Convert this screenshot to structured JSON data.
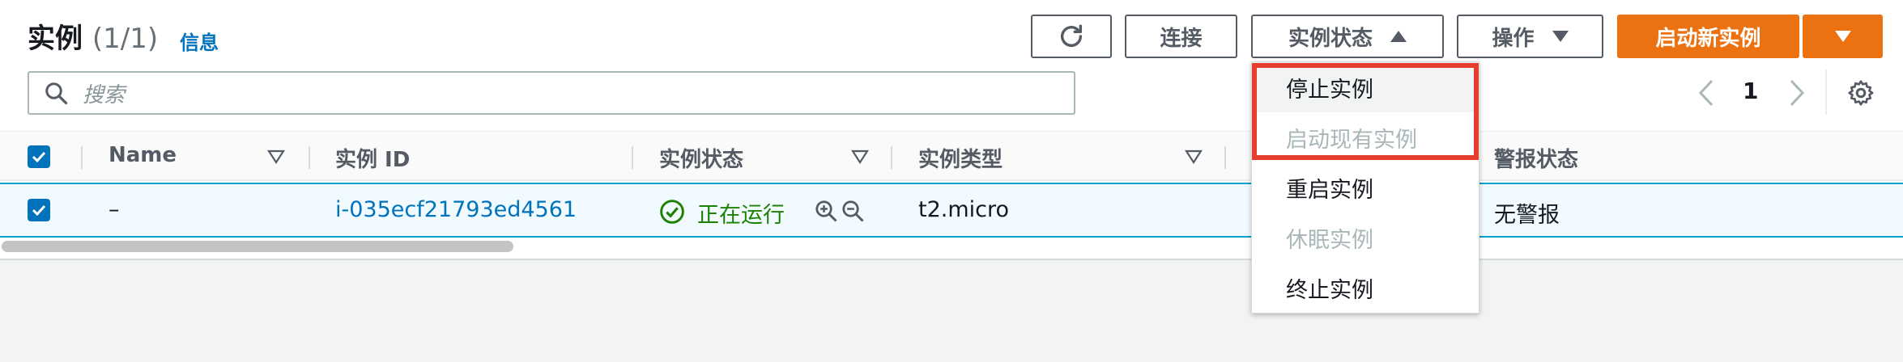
{
  "header": {
    "title": "实例",
    "count": "(1/1)",
    "info_link": "信息"
  },
  "toolbar": {
    "connect_label": "连接",
    "instance_state_label": "实例状态",
    "actions_label": "操作",
    "launch_label": "启动新实例"
  },
  "search": {
    "placeholder": "搜索"
  },
  "pagination": {
    "current_page": "1"
  },
  "table": {
    "columns": [
      "Name",
      "实例 ID",
      "实例状态",
      "实例类型",
      "警报状态"
    ],
    "rows": [
      {
        "name": "–",
        "instance_id": "i-035ecf21793ed4561",
        "state": "正在运行",
        "type": "t2.micro",
        "alarm": "无警报"
      }
    ]
  },
  "state_menu": {
    "items": [
      {
        "label": "停止实例",
        "enabled": true
      },
      {
        "label": "启动现有实例",
        "enabled": false
      },
      {
        "label": "重启实例",
        "enabled": true
      },
      {
        "label": "休眠实例",
        "enabled": false
      },
      {
        "label": "终止实例",
        "enabled": true
      }
    ]
  },
  "colors": {
    "accent": "#ec7211",
    "link": "#0073bb",
    "running": "#1d8102",
    "highlight": "#e53e2e"
  }
}
